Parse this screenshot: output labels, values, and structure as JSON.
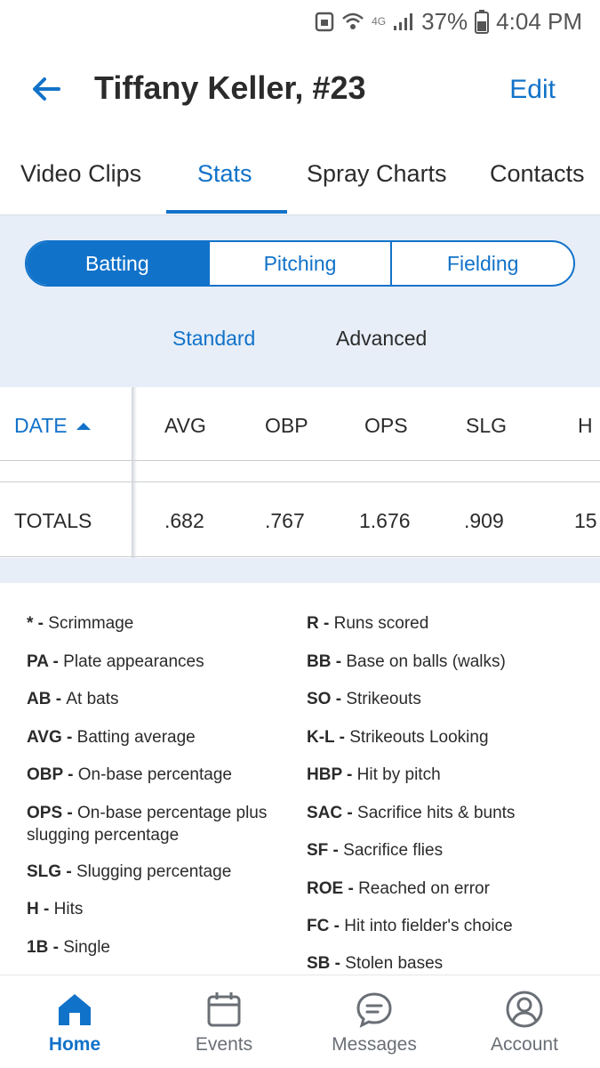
{
  "status_bar": {
    "network": "4G",
    "battery": "37%",
    "time": "4:04 PM"
  },
  "header": {
    "title": "Tiffany Keller, #23",
    "edit": "Edit"
  },
  "tabs": [
    {
      "label": "Video Clips"
    },
    {
      "label": "Stats"
    },
    {
      "label": "Spray Charts"
    },
    {
      "label": "Contacts"
    }
  ],
  "stat_type": [
    "Batting",
    "Pitching",
    "Fielding"
  ],
  "subtabs": [
    "Standard",
    "Advanced"
  ],
  "table": {
    "headers": [
      "DATE",
      "AVG",
      "OBP",
      "OPS",
      "SLG",
      "H"
    ],
    "totals": [
      "TOTALS",
      ".682",
      ".767",
      "1.676",
      ".909",
      "15"
    ]
  },
  "legend": {
    "left": [
      {
        "abbr": "*",
        "desc": "Scrimmage"
      },
      {
        "abbr": "PA",
        "desc": "Plate appearances"
      },
      {
        "abbr": "AB",
        "desc": "At bats"
      },
      {
        "abbr": "AVG",
        "desc": "Batting average"
      },
      {
        "abbr": "OBP",
        "desc": "On-base percentage"
      },
      {
        "abbr": "OPS",
        "desc": "On-base percentage plus slugging percentage"
      },
      {
        "abbr": "SLG",
        "desc": "Slugging percentage"
      },
      {
        "abbr": "H",
        "desc": "Hits"
      },
      {
        "abbr": "1B",
        "desc": "Single"
      }
    ],
    "right": [
      {
        "abbr": "R",
        "desc": "Runs scored"
      },
      {
        "abbr": "BB",
        "desc": "Base on balls (walks)"
      },
      {
        "abbr": "SO",
        "desc": "Strikeouts"
      },
      {
        "abbr": "K-L",
        "desc": "Strikeouts Looking"
      },
      {
        "abbr": "HBP",
        "desc": "Hit by pitch"
      },
      {
        "abbr": "SAC",
        "desc": "Sacrifice hits & bunts"
      },
      {
        "abbr": "SF",
        "desc": "Sacrifice flies"
      },
      {
        "abbr": "ROE",
        "desc": "Reached on error"
      },
      {
        "abbr": "FC",
        "desc": "Hit into fielder's choice"
      },
      {
        "abbr": "SB",
        "desc": "Stolen bases"
      }
    ]
  },
  "bottom_nav": [
    {
      "label": "Home",
      "icon": "home-icon"
    },
    {
      "label": "Events",
      "icon": "calendar-icon"
    },
    {
      "label": "Messages",
      "icon": "chat-icon"
    },
    {
      "label": "Account",
      "icon": "account-icon"
    }
  ],
  "colors": {
    "accent": "#1172c9",
    "panel": "#e7eef8",
    "text": "#2b2b2b",
    "muted": "#6a6f76"
  }
}
